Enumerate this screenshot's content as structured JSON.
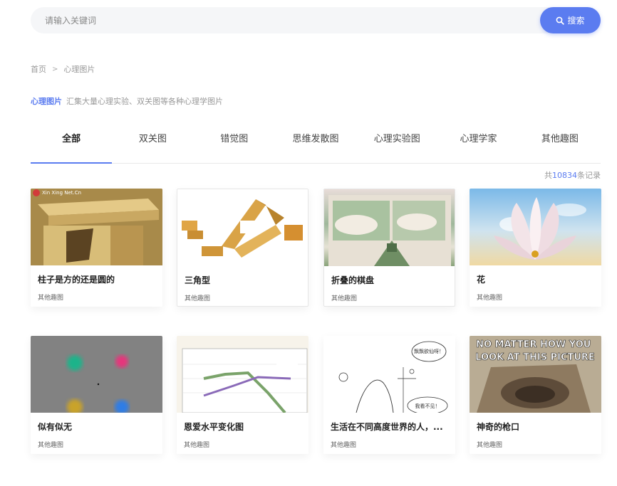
{
  "search": {
    "placeholder": "请输入关键词",
    "button_label": "搜索"
  },
  "breadcrumb": {
    "home": "首页",
    "separator": ">",
    "current": "心理图片"
  },
  "intro": {
    "title": "心理图片",
    "description": "汇集大量心理实验、双关图等各种心理学图片"
  },
  "tabs": [
    {
      "label": "全部",
      "active": true
    },
    {
      "label": "双关图",
      "active": false
    },
    {
      "label": "错觉图",
      "active": false
    },
    {
      "label": "思维发散图",
      "active": false
    },
    {
      "label": "心理实验图",
      "active": false
    },
    {
      "label": "心理学家",
      "active": false
    },
    {
      "label": "其他趣图",
      "active": false
    }
  ],
  "records": {
    "prefix": "共",
    "count": "10834",
    "suffix": "条记录"
  },
  "cards": [
    {
      "title": "柱子是方的还是圆的",
      "category": "其他趣图",
      "watermark": "Xin Xing Net.Cn"
    },
    {
      "title": "三角型",
      "category": "其他趣图"
    },
    {
      "title": "折叠的棋盘",
      "category": "其他趣图"
    },
    {
      "title": "花",
      "category": "其他趣图"
    },
    {
      "title": "似有似无",
      "category": "其他趣图"
    },
    {
      "title": "恩爱水平变化图",
      "category": "其他趣图"
    },
    {
      "title": "生活在不同高度世界的人，...",
      "category": "其他趣图",
      "bubble_top": "飘飘欲仙呀！",
      "bubble_bottom": "我看不见！"
    },
    {
      "title": "神奇的枪口",
      "category": "其他趣图",
      "caption": "NO MATTER HOW YOU LOOK AT THIS PICTURE"
    }
  ],
  "colors": {
    "accent": "#5b7cf0"
  }
}
